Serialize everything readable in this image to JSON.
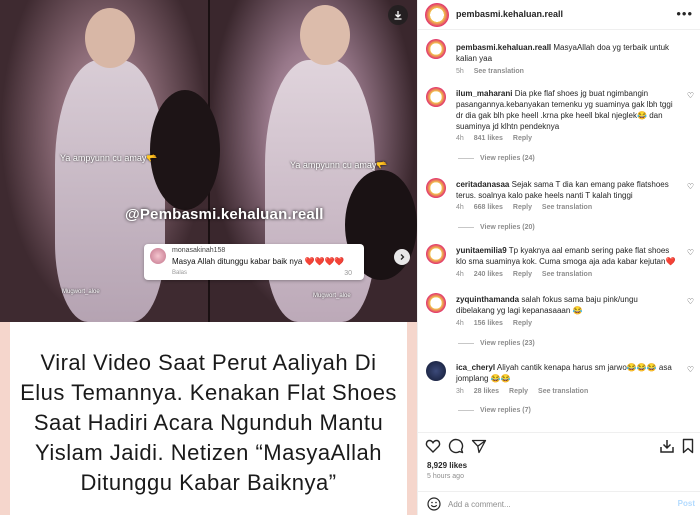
{
  "media": {
    "overlay_text_left": "Ya ampyunn cu amay🫳",
    "overlay_text_right": "Ya ampyunn cu amay🫳",
    "watermark": "@Pembasmi.kehaluan.reall",
    "small_wm_left": "Mugwort_aloe",
    "small_wm_right": "Mugwort_aloe",
    "embedded_comment": {
      "username": "monasakinah158",
      "text": "Masya Allah ditunggu kabar baik nya ❤️❤️❤️❤️",
      "reply": "Balas",
      "likes": "30"
    },
    "caption": "Viral Video Saat Perut Aaliyah Di Elus Temannya. Kenakan Flat Shoes Saat Hadiri Acara Ngunduh Mantu Yislam Jaidi. Netizen “MasyaAllah Ditunggu Kabar Baiknya”"
  },
  "header": {
    "username": "pembasmi.kehaluan.reall",
    "more": "•••"
  },
  "comments": [
    {
      "username": "pembasmi.kehaluan.reall",
      "text": "MasyaAllah doa yg terbaik untuk kalian yaa",
      "time": "5h",
      "actions": [
        "See translation"
      ]
    },
    {
      "username": "ilum_maharani",
      "text": "Dia pke flaf shoes jg buat ngimbangin pasangannya.kebanyakan temenku yg suaminya gak lbh tggi dr dia gak blh pke heell .krna pke heell bkal njeglek😂 dan suaminya jd klhtn pendeknya",
      "time": "4h",
      "likes": "841 likes",
      "actions": [
        "Reply"
      ],
      "replies": "View replies (24)"
    },
    {
      "username": "ceritadanasaa",
      "text": "Sejak sama T dia kan emang pake flatshoes terus. soalnya kalo pake heels nanti T kalah tinggi",
      "time": "4h",
      "likes": "668 likes",
      "actions": [
        "Reply",
        "See translation"
      ],
      "replies": "View replies (20)"
    },
    {
      "username": "yunitaemilia9",
      "text": "Tp kyaknya aal emanb sering pake flat shoes klo sma suaminya kok. Cuma smoga aja ada kabar kejutan❤️",
      "time": "4h",
      "likes": "240 likes",
      "actions": [
        "Reply",
        "See translation"
      ],
      "replies": ""
    },
    {
      "username": "zyquinthamanda",
      "text": "salah fokus sama baju pink/ungu dibelakang yg lagi kepanasaaan 😂",
      "time": "4h",
      "likes": "156 likes",
      "actions": [
        "Reply"
      ],
      "replies": "View replies (23)"
    },
    {
      "username": "ica_cheryl",
      "text": "Aliyah cantik kenapa harus sm jarwo😂😂😂 asa jomplang 😂😂",
      "time": "3h",
      "likes": "28 likes",
      "actions": [
        "Reply",
        "See translation"
      ],
      "replies": "View replies (7)"
    }
  ],
  "footer": {
    "likes": "8,929 likes",
    "time_ago": "5 hours ago",
    "add_comment_placeholder": "Add a comment...",
    "post_label": "Post"
  },
  "colors": {
    "link_blue": "#b3dbff",
    "muted_gray": "#8e8e8e",
    "text": "#262626",
    "media_bg": "#f5d6cc"
  }
}
